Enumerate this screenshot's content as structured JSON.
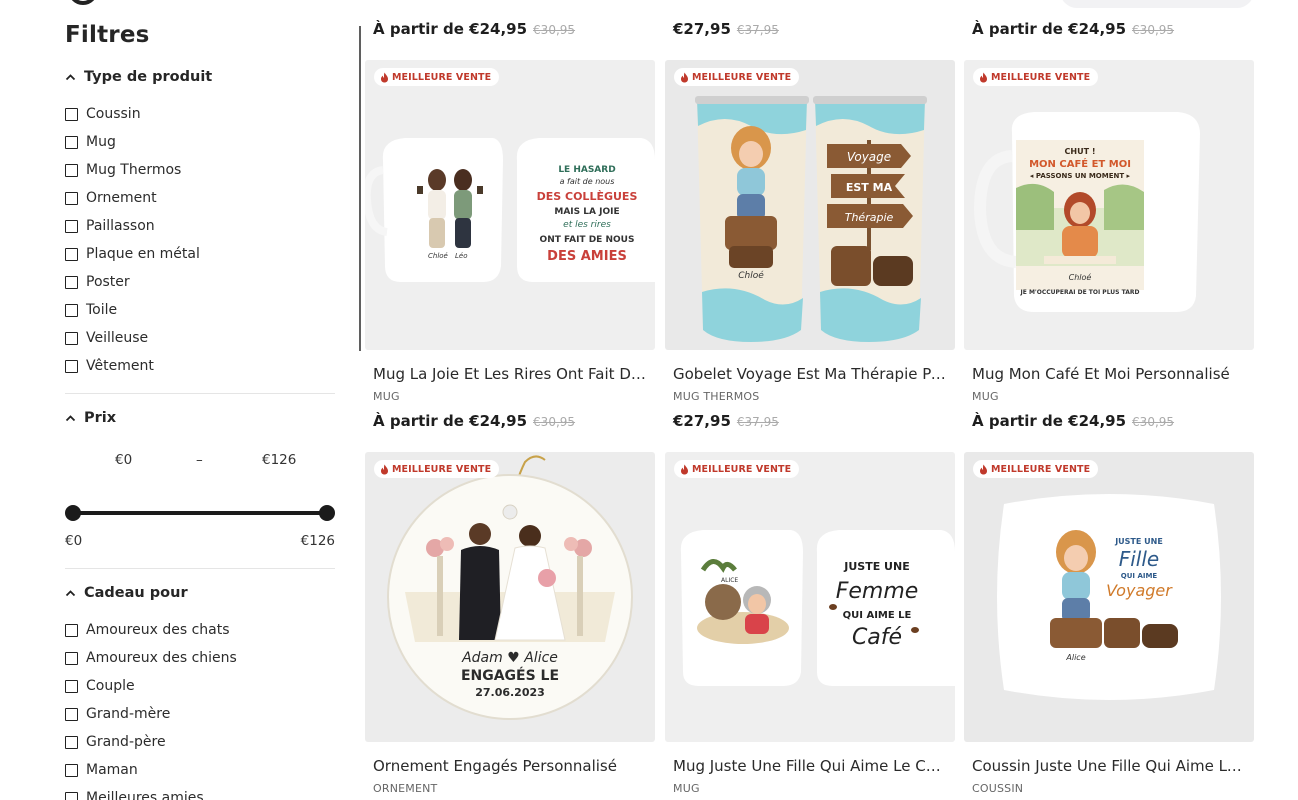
{
  "sidebar": {
    "title": "Filtres",
    "product_type": {
      "heading": "Type de produit",
      "options": [
        "Coussin",
        "Mug",
        "Mug Thermos",
        "Ornement",
        "Paillasson",
        "Plaque en métal",
        "Poster",
        "Toile",
        "Veilleuse",
        "Vêtement"
      ]
    },
    "price": {
      "heading": "Prix",
      "min_input": "€0",
      "separator": "–",
      "max_input": "€126",
      "range_min_label": "€0",
      "range_max_label": "€126"
    },
    "gift_for": {
      "heading": "Cadeau pour",
      "options": [
        "Amoureux des chats",
        "Amoureux des chiens",
        "Couple",
        "Grand-mère",
        "Grand-père",
        "Maman",
        "Meilleures amies"
      ]
    }
  },
  "top_row": [
    {
      "price": "À partir de €24,95",
      "old_price": "€30,95"
    },
    {
      "price": "€27,95",
      "old_price": "€37,95"
    },
    {
      "price": "À partir de €24,95",
      "old_price": "€30,95"
    }
  ],
  "products": [
    {
      "badge": "MEILLEURE VENTE",
      "title": "Mug La Joie Et Les Rires Ont Fait De Nous Des Amies",
      "category": "MUG",
      "price": "À partir de €24,95",
      "old_price": "€30,95",
      "image_text": [
        "Chloé",
        "Léo",
        "LE HASARD",
        "a fait de nous",
        "DES COLLÈGUES",
        "MAIS LA JOIE",
        "et les rires",
        "ONT FAIT DE NOUS",
        "DES AMIES"
      ]
    },
    {
      "badge": "MEILLEURE VENTE",
      "title": "Gobelet Voyage Est Ma Thérapie Personnalisé",
      "category": "MUG THERMOS",
      "price": "€27,95",
      "old_price": "€37,95",
      "image_text": [
        "Chloé",
        "Voyage",
        "EST MA",
        "Thérapie"
      ]
    },
    {
      "badge": "MEILLEURE VENTE",
      "title": "Mug Mon Café Et Moi Personnalisé",
      "category": "MUG",
      "price": "À partir de €24,95",
      "old_price": "€30,95",
      "image_text": [
        "CHUT !",
        "MON CAFÉ ET MOI",
        "◂ PASSONS UN MOMENT ▸",
        "Chloé",
        "JE M'OCCUPERAI DE TOI PLUS TARD"
      ]
    },
    {
      "badge": "MEILLEURE VENTE",
      "title": "Ornement Engagés Personnalisé",
      "category": "ORNEMENT",
      "price": "",
      "old_price": "",
      "image_text": [
        "Adam ♥ Alice",
        "ENGAGÉS LE",
        "27.06.2023"
      ]
    },
    {
      "badge": "MEILLEURE VENTE",
      "title": "Mug Juste Une Fille Qui Aime Le Café Personnalisé",
      "category": "MUG",
      "price": "",
      "old_price": "",
      "image_text": [
        "ALICE",
        "JUSTE UNE",
        "Femme",
        "QUI AIME LE",
        "Café"
      ]
    },
    {
      "badge": "MEILLEURE VENTE",
      "title": "Coussin Juste Une Fille Qui Aime Le Voyage Personnalisé",
      "category": "COUSSIN",
      "price": "",
      "old_price": "",
      "image_text": [
        "JUSTE UNE",
        "Fille",
        "QUI AIME",
        "Voyager",
        "Alice"
      ]
    }
  ],
  "colors": {
    "badge_text": "#c0392b",
    "text": "#1e1e1e",
    "strike": "#aaaaaa",
    "slider": "#1b1b1b"
  },
  "icons": [
    "logo-icon",
    "chevron-up-icon",
    "flame-icon",
    "checkbox-icon"
  ]
}
